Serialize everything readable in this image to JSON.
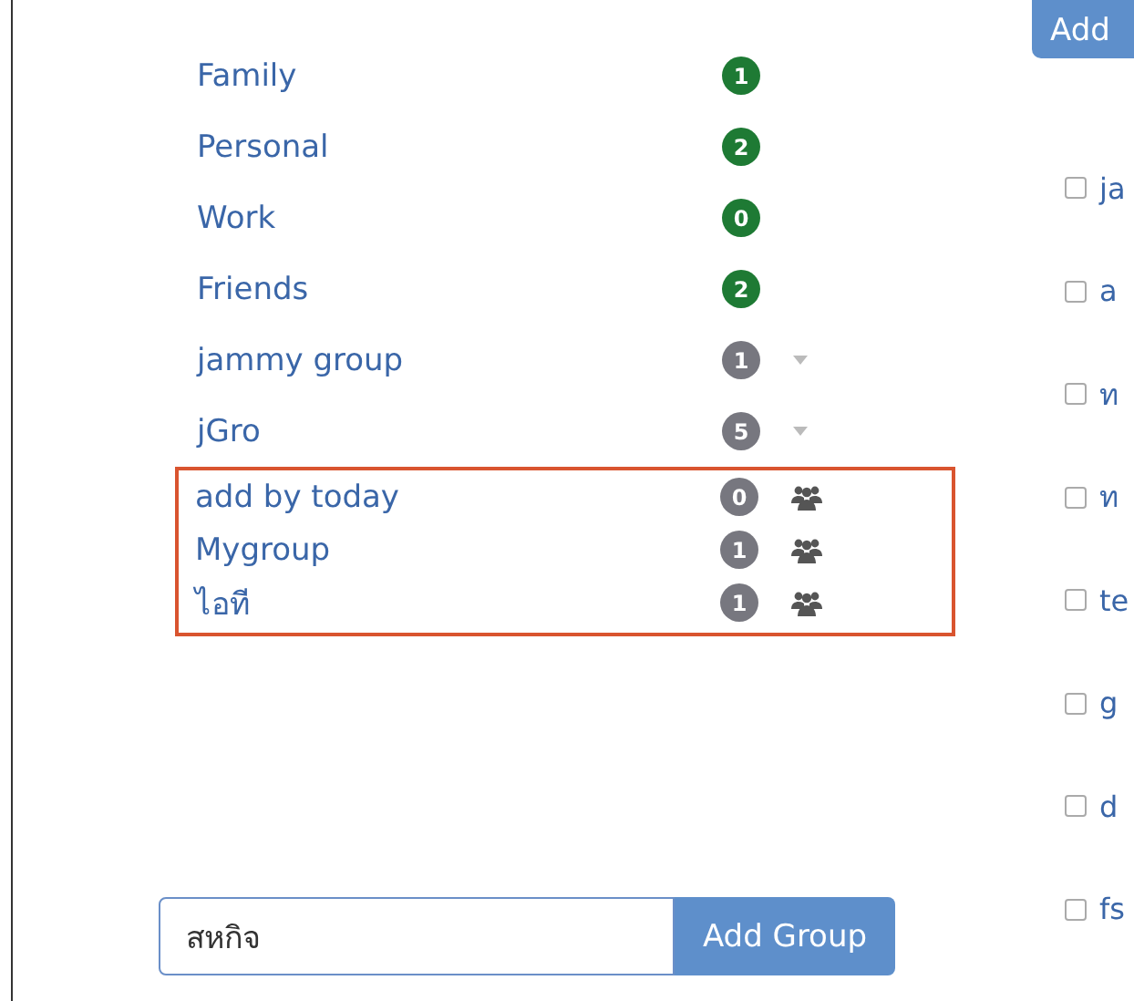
{
  "sections": [
    {
      "highlighted": false,
      "groups": [
        {
          "name": "Family",
          "count": "1",
          "color": "#1e7a34",
          "kind": "plain"
        },
        {
          "name": "Personal",
          "count": "2",
          "color": "#1e7a34",
          "kind": "plain"
        },
        {
          "name": "Work",
          "count": "0",
          "color": "#1e7a34",
          "kind": "plain"
        },
        {
          "name": "Friends",
          "count": "2",
          "color": "#1e7a34",
          "kind": "plain"
        },
        {
          "name": "jammy group",
          "count": "1",
          "color": "#77777f",
          "kind": "dropdown"
        },
        {
          "name": "jGro",
          "count": "5",
          "color": "#77777f",
          "kind": "dropdown"
        }
      ]
    },
    {
      "highlighted": true,
      "groups": [
        {
          "name": "add by today",
          "count": "0",
          "color": "#77777f",
          "kind": "shared"
        },
        {
          "name": "Mygroup",
          "count": "1",
          "color": "#77777f",
          "kind": "shared"
        },
        {
          "name": "ไอที",
          "count": "1",
          "color": "#77777f",
          "kind": "shared"
        }
      ]
    }
  ],
  "new_group": {
    "value": "สหกิจ",
    "button": "Add Group"
  },
  "contacts": {
    "add_button": "Add",
    "items": [
      {
        "name": "ja",
        "checked": false
      },
      {
        "name": "a",
        "checked": false
      },
      {
        "name": "ท",
        "checked": false
      },
      {
        "name": "ท",
        "checked": false
      },
      {
        "name": "te",
        "checked": false
      },
      {
        "name": "g",
        "checked": false
      },
      {
        "name": "d",
        "checked": false
      },
      {
        "name": "fs",
        "checked": false
      }
    ]
  }
}
